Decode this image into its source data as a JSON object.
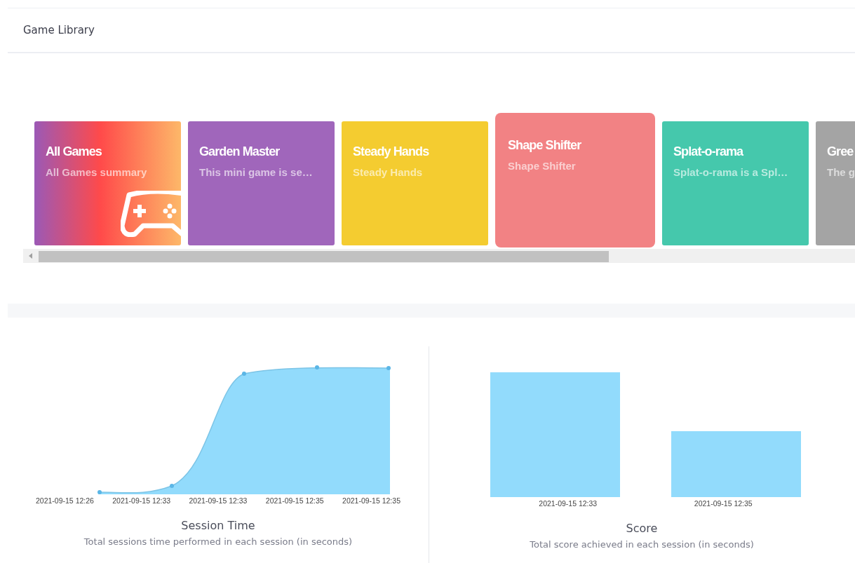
{
  "header": {
    "title": "Game Library"
  },
  "games": [
    {
      "title": "All Games",
      "description": "All Games summary",
      "kind": "gradient",
      "selected": false
    },
    {
      "title": "Garden Master",
      "description": "This mini game is se…",
      "kind": "solid",
      "color": "#a066bb",
      "selected": false
    },
    {
      "title": "Steady Hands",
      "description": "Steady Hands",
      "kind": "solid",
      "color": "#f4cc30",
      "selected": false
    },
    {
      "title": "Shape Shifter",
      "description": "Shape Shifter",
      "kind": "solid",
      "color": "#f28284",
      "selected": true
    },
    {
      "title": "Splat-o-rama",
      "description": "Splat-o-rama is a Spl…",
      "kind": "solid",
      "color": "#45c8ac",
      "selected": false
    },
    {
      "title": "Gree",
      "description": "The g",
      "kind": "solid",
      "color": "#a4a4a4",
      "selected": false
    }
  ],
  "charts": [
    {
      "kind": "area",
      "title": "Session Time",
      "subtitle": "Total sessions time performed in each session (in seconds)",
      "x_labels": [
        "2021-09-15 12:26",
        "2021-09-15 12:33",
        "2021-09-15 12:33",
        "2021-09-15 12:35",
        "2021-09-15 12:35"
      ]
    },
    {
      "kind": "bar",
      "title": "Score",
      "subtitle": "Total score achieved in each session (in seconds)",
      "x_labels": [
        "2021-09-15 12:33",
        "2021-09-15 12:35"
      ]
    }
  ]
}
